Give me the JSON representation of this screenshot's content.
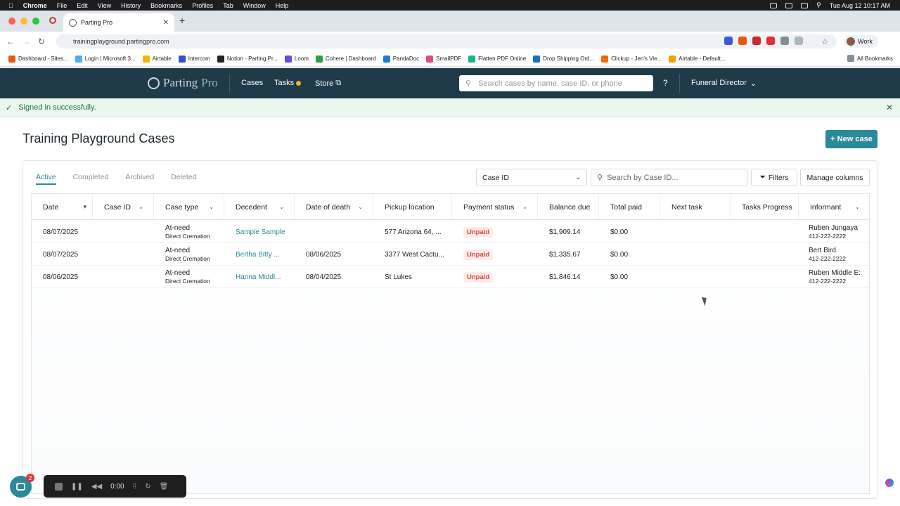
{
  "menubar": {
    "app": "Chrome",
    "items": [
      "File",
      "Edit",
      "View",
      "History",
      "Bookmarks",
      "Profiles",
      "Tab",
      "Window",
      "Help"
    ],
    "clock": "Tue Aug 12  10:17 AM"
  },
  "browser": {
    "tab_title": "Parting Pro",
    "url": "trainingplayground.partingpro.com",
    "profile": "Work",
    "bookmarks": [
      "Dashboard - Sites...",
      "Login | Microsoft 3...",
      "Airtable",
      "Intercom",
      "Notion - Parting Pr...",
      "Loom",
      "Cohere | Dashboard",
      "PandaDoc",
      "SmallPDF",
      "Flatten PDF Online",
      "Drop Shipping Ord...",
      "Clickup - Jen's Vie...",
      "Airtable - Default..."
    ],
    "all_bookmarks": "All Bookmarks"
  },
  "app_nav": {
    "logo_main": "Parting",
    "logo_accent": "Pro",
    "cases": "Cases",
    "tasks": "Tasks",
    "store": "Store",
    "search_placeholder": "Search cases by name, case ID, or phone",
    "help": "?",
    "role": "Funeral Director"
  },
  "alert": {
    "message": "Signed in successfully."
  },
  "page": {
    "title": "Training Playground Cases",
    "new_case": "+ New case"
  },
  "tabs": [
    "Active",
    "Completed",
    "Archived",
    "Deleted"
  ],
  "toolbar": {
    "select_value": "Case ID",
    "search_placeholder": "Search by Case ID...",
    "filters": "Filters",
    "manage_columns": "Manage columns"
  },
  "table": {
    "columns": [
      "Date",
      "Case ID",
      "Case type",
      "Decedent",
      "Date of death",
      "Pickup location",
      "Payment status",
      "Balance due",
      "Total paid",
      "Next task",
      "Tasks Progress",
      "Informant"
    ],
    "rows": [
      {
        "date": "08/07/2025",
        "case_id": "",
        "case_type": "At-need",
        "case_sub": "Direct Cremation",
        "decedent": "Sample Sample",
        "dod": "",
        "pickup": "577 Arizona 64, ...",
        "status": "Unpaid",
        "balance": "$1,909.14",
        "paid": "$0.00",
        "next": "",
        "progress": "",
        "informant": "Ruben Jungaya",
        "phone": "412-222-2222"
      },
      {
        "date": "08/07/2025",
        "case_id": "",
        "case_type": "At-need",
        "case_sub": "Direct Cremation",
        "decedent": "Bertha Bitty ...",
        "dod": "08/06/2025",
        "pickup": "3377 West Cactu...",
        "status": "Unpaid",
        "balance": "$1,335.67",
        "paid": "$0.00",
        "next": "",
        "progress": "",
        "informant": "Bert Bird",
        "phone": "412-222-2222"
      },
      {
        "date": "08/06/2025",
        "case_id": "",
        "case_type": "At-need",
        "case_sub": "Direct Cremation",
        "decedent": "Hanna Middl...",
        "dod": "08/04/2025",
        "pickup": "St Lukes",
        "status": "Unpaid",
        "balance": "$1,846.14",
        "paid": "$0.00",
        "next": "",
        "progress": "",
        "informant": "Ruben Middle E:",
        "phone": "412-222-2222"
      }
    ]
  },
  "recorder": {
    "time": "0:00"
  },
  "chat": {
    "count": "2"
  },
  "colors": {
    "nav_bg": "#1f3a48",
    "accent": "#2b8a99",
    "unpaid": "#d14b3c",
    "success": "#1f7a3f"
  }
}
